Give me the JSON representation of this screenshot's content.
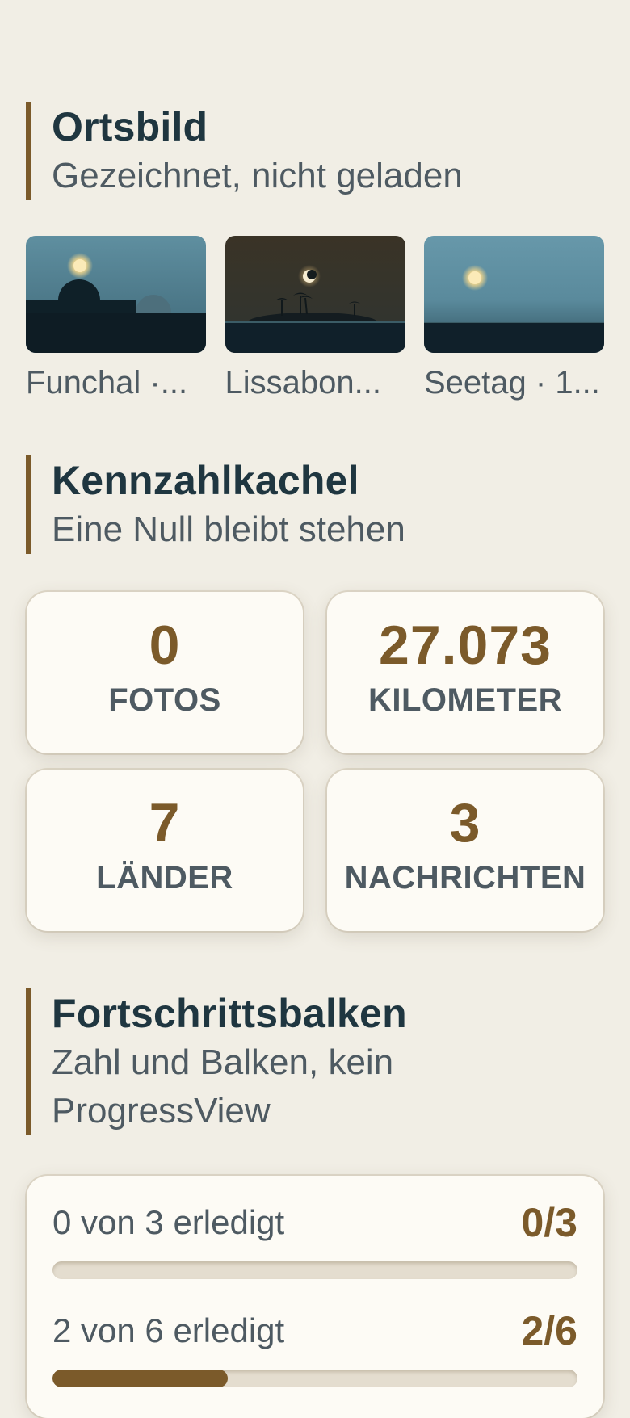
{
  "sections": {
    "ortsbild": {
      "title": "Ortsbild",
      "subtitle": "Gezeichnet, nicht geladen"
    },
    "kennzahl": {
      "title": "Kennzahlkachel",
      "subtitle": "Eine Null bleibt stehen"
    },
    "fortschritt": {
      "title": "Fortschrittsbalken",
      "subtitle": "Zahl und Balken, kein ProgressView"
    }
  },
  "places": [
    {
      "label": "Funchal ·...",
      "icon": "harbor-dome-scene"
    },
    {
      "label": "Lissabon...",
      "icon": "night-palm-island-scene"
    },
    {
      "label": "Seetag · 1...",
      "icon": "open-sea-sun-scene"
    }
  ],
  "stats": [
    {
      "value": "0",
      "label": "FOTOS"
    },
    {
      "value": "27.073",
      "label": "KILOMETER"
    },
    {
      "value": "7",
      "label": "LÄNDER"
    },
    {
      "value": "3",
      "label": "NACHRICHTEN"
    }
  ],
  "progress": [
    {
      "text": "0 von 3 erledigt",
      "count": "0/3",
      "fraction": 0
    },
    {
      "text": "2 von 6 erledigt",
      "count": "2/6",
      "fraction": 0.3333
    }
  ],
  "colors": {
    "background": "#f1eee5",
    "accent": "#7b5a2a",
    "card": "#fdfbf5",
    "title": "#1f3640",
    "muted": "#4e5a62"
  }
}
